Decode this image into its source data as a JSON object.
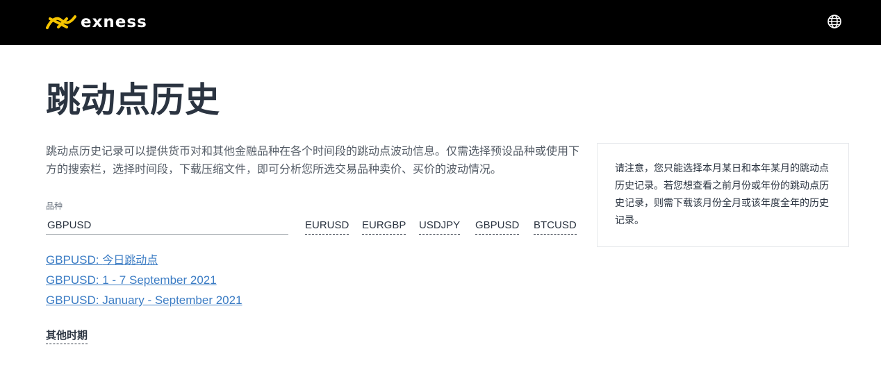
{
  "header": {
    "brand": "exness",
    "language_icon": "globe-icon",
    "brand_color": "#f5c400"
  },
  "page": {
    "title": "跳动点历史",
    "intro": "跳动点历史记录可以提供货币对和其他金融品种在各个时间段的跳动点波动信息。仅需选择预设品种或使用下方的搜索栏，选择时间段，下载压缩文件，即可分析您所选交易品种卖价、买价的波动情况。"
  },
  "instrument": {
    "label": "品种",
    "value": "GBPUSD",
    "presets": [
      "EURUSD",
      "EURGBP",
      "USDJPY",
      "GBPUSD",
      "BTCUSD"
    ]
  },
  "downloads": {
    "today_prefix": "GBPUSD: ",
    "today_label": "今日跳动点",
    "week": "GBPUSD: 1 - 7 September 2021",
    "months": "GBPUSD: January - September 2021"
  },
  "other_periods": "其他时期",
  "notice": "请注意，您只能选择本月某日和本年某月的跳动点历史记录。若您想查看之前月份或年份的跳动点历史记录，则需下载该月份全月或该年度全年的历史记录。"
}
